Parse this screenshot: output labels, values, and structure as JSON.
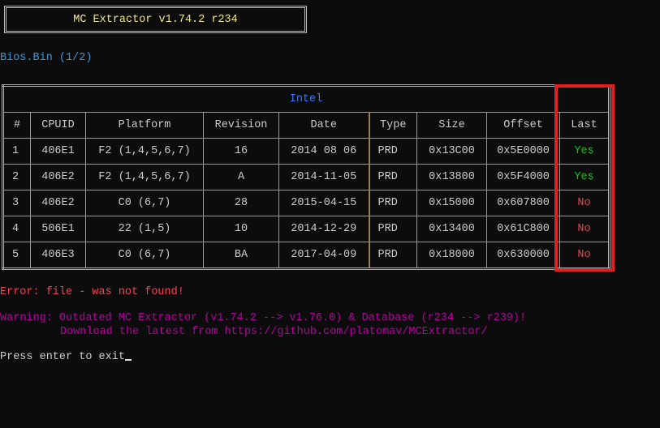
{
  "title": "MC Extractor v1.74.2 r234",
  "file_label": "Bios.Bin (1/2)",
  "table": {
    "group_title": "Intel",
    "headers": [
      "#",
      "CPUID",
      "Platform",
      "Revision",
      "Date",
      "Type",
      "Size",
      "Offset",
      "Last"
    ],
    "rows": [
      [
        "1",
        "406E1",
        "F2 (1,4,5,6,7)",
        "16",
        "2014 08 06",
        "PRD",
        "0x13C00",
        "0x5E0000",
        "Yes"
      ],
      [
        "2",
        "406E2",
        "F2 (1,4,5,6,7)",
        "A",
        "2014-11-05",
        "PRD",
        "0x13800",
        "0x5F4000",
        "Yes"
      ],
      [
        "3",
        "406E2",
        "C0 (6,7)",
        "28",
        "2015-04-15",
        "PRD",
        "0x15000",
        "0x607800",
        "No"
      ],
      [
        "4",
        "506E1",
        "22 (1,5)",
        "10",
        "2014-12-29",
        "PRD",
        "0x13400",
        "0x61C800",
        "No"
      ],
      [
        "5",
        "406E3",
        "C0 (6,7)",
        "BA",
        "2017-04-09",
        "PRD",
        "0x18000",
        "0x630000",
        "No"
      ]
    ]
  },
  "error": "Error: file - was not found!",
  "warning_line1": "Warning: Outdated MC Extractor (v1.74.2 --> v1.76.0) & Database (r234 --> r239)!",
  "warning_line2": "Download the latest from https://github.com/platomav/MCExtractor/",
  "prompt": "Press enter to exit",
  "colors": {
    "yes": "#16c60c",
    "no": "#e74856",
    "highlight": "#e0201f"
  }
}
